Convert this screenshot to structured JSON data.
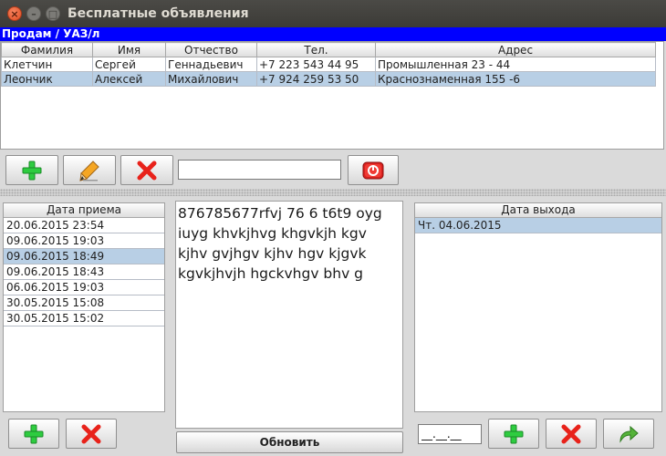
{
  "window": {
    "title": "Бесплатные объявления"
  },
  "category": "Продам / УАЗ/л",
  "contacts": {
    "columns": [
      "Фамилия",
      "Имя",
      "Отчество",
      "Тел.",
      "Адрес"
    ],
    "rows": [
      [
        "Клетчин",
        "Сергей",
        "Геннадьевич",
        "+7 223 543 44 95",
        "Промышленная 23 - 44"
      ],
      [
        "Леончик",
        "Алексей",
        "Михайлович",
        "+7 924 259 53 50",
        "Краснознаменная 155 -6"
      ]
    ],
    "selected_row": 1
  },
  "search": {
    "value": ""
  },
  "received": {
    "header": "Дата приема",
    "items": [
      "20.06.2015 23:54",
      "09.06.2015 19:03",
      "09.06.2015 18:49",
      "09.06.2015 18:43",
      "06.06.2015 19:03",
      "30.05.2015 15:08",
      "30.05.2015 15:02"
    ],
    "selected_index": 2
  },
  "message": {
    "text": "876785677rfvj 76 6 t6t9 oyg iuyg khvkjhvg khgvkjh kgv kjhv gvjhgv kjhv hgv kjgvk kgvkjhvjh hgckvhgv bhv g"
  },
  "refresh_label": "Обновить",
  "release": {
    "header": "Дата выхода",
    "items": [
      "Чт. 04.06.2015"
    ],
    "selected_index": 0
  },
  "date_input": {
    "value": "__.__.__"
  },
  "colors": {
    "accent_blue": "#0000ff",
    "selection": "#b8cfe5",
    "add_green": "#2ecc40",
    "delete_red": "#e8221a"
  },
  "icons": [
    "add-icon",
    "edit-pencil-icon",
    "delete-icon",
    "stop-icon",
    "forward-arrow-icon"
  ]
}
